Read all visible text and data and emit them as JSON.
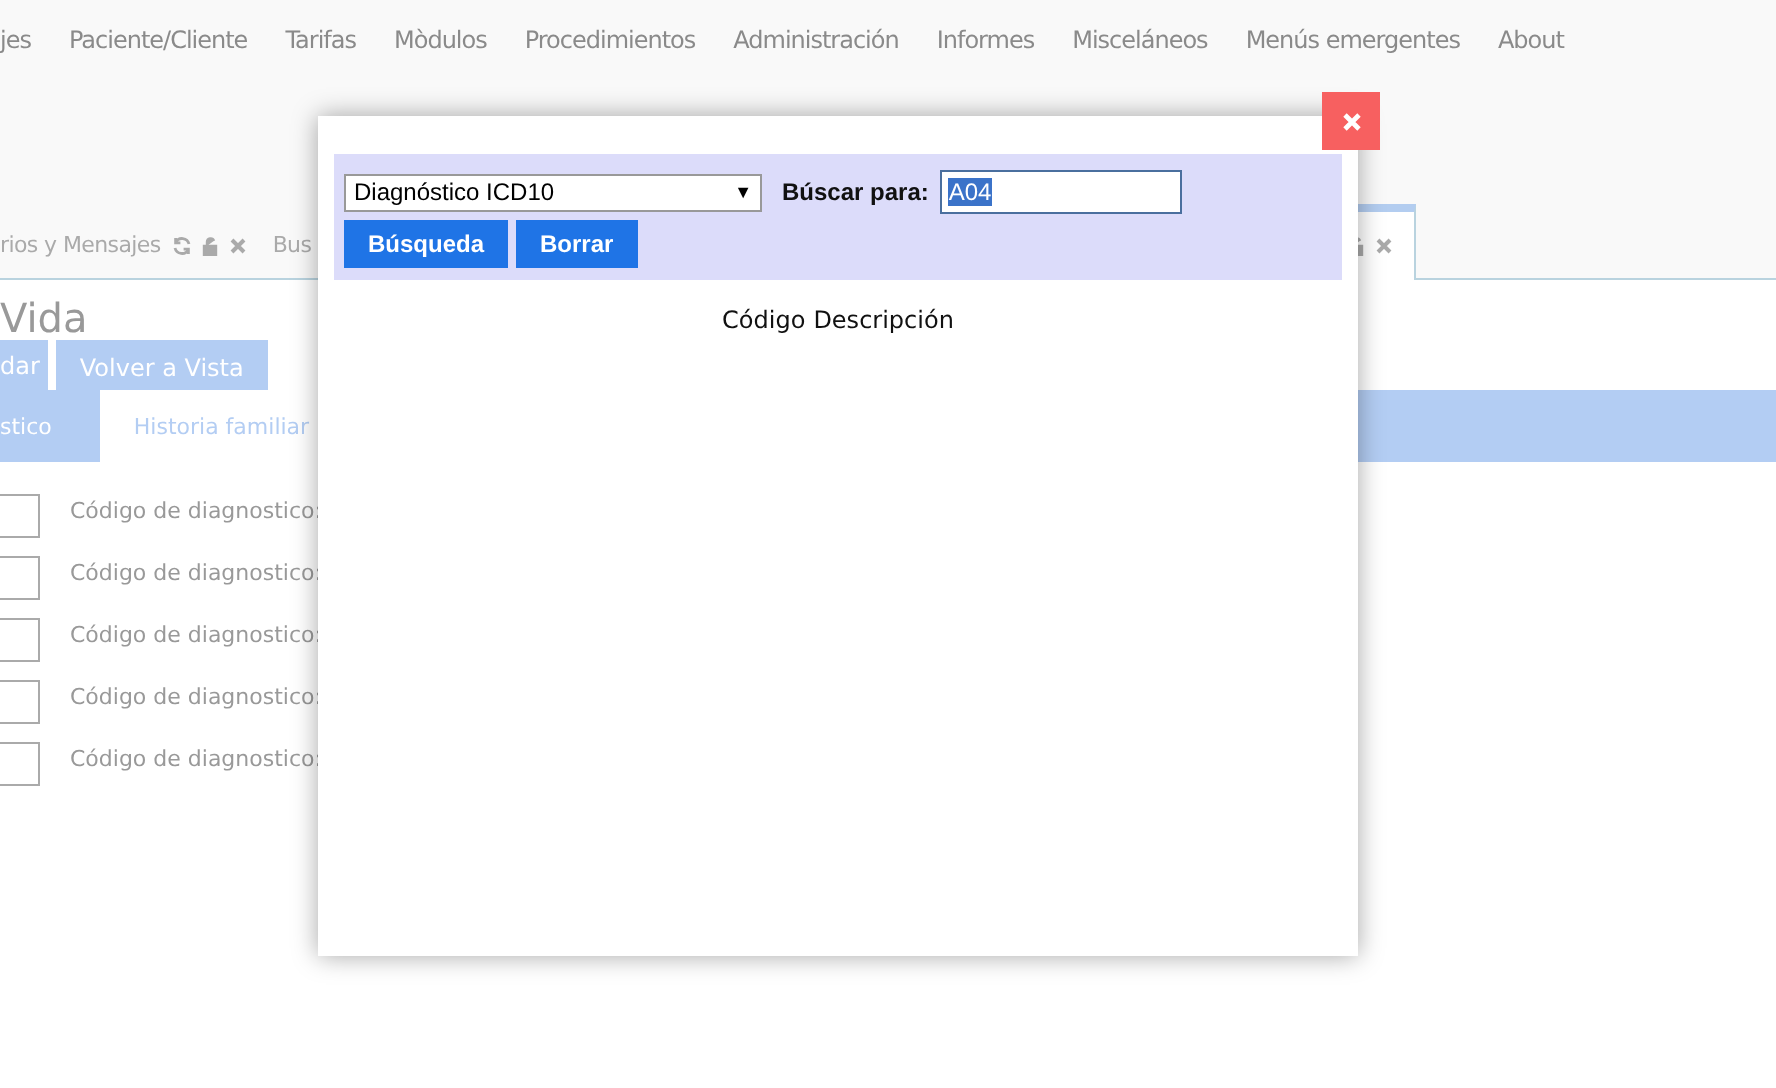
{
  "menu": {
    "items": [
      "jes",
      "Paciente/Cliente",
      "Tarifas",
      "Mòdulos",
      "Procedimientos",
      "Administración",
      "Informes",
      "Misceláneos",
      "Menús emergentes",
      "About"
    ]
  },
  "tabs": [
    {
      "label": "rios y Mensajes",
      "selected": false,
      "icons": true
    },
    {
      "label": "Bus",
      "selected": false,
      "icons": false
    },
    {
      "selected": true,
      "icons": true
    }
  ],
  "page": {
    "title": "Vida",
    "buttons": [
      {
        "label": "dar",
        "selected": false
      },
      {
        "label": "Volver a Vista",
        "selected": true
      }
    ],
    "section_tabs": [
      {
        "label": "stico",
        "selected": true
      },
      {
        "label": "Historia familiar",
        "selected": false
      }
    ],
    "rows": [
      {
        "label": "Código de diagnostico:"
      },
      {
        "label": "Código de diagnostico:"
      },
      {
        "label": "Código de diagnostico:"
      },
      {
        "label": "Código de diagnostico:"
      },
      {
        "label": "Código de diagnostico:"
      }
    ]
  },
  "modal": {
    "select": {
      "value": "Diagnóstico ICD10",
      "caret": "▼"
    },
    "search_label": "Búscar para:",
    "search": {
      "value": "A04",
      "selected_text": true
    },
    "buttons": [
      "Búsqueda",
      "Borrar"
    ],
    "columns": [
      "Código",
      "Descripción"
    ]
  }
}
